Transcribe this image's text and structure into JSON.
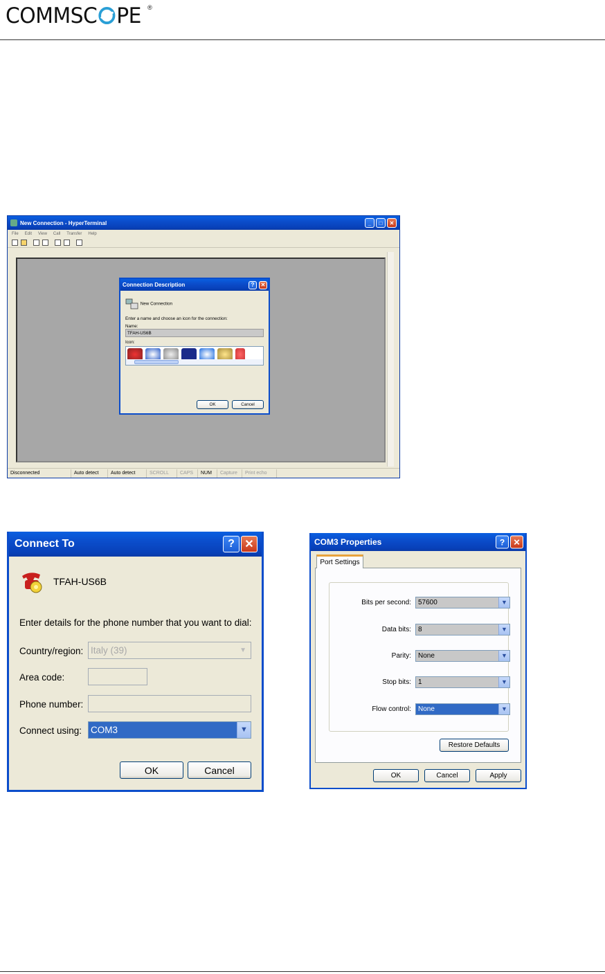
{
  "header": {
    "logo_text_1": "COMMSC",
    "logo_text_2": "PE",
    "logo_reg": "®"
  },
  "hyperterminal": {
    "title": "New Connection - HyperTerminal",
    "menu": [
      "File",
      "Edit",
      "View",
      "Call",
      "Transfer",
      "Help"
    ],
    "status": [
      "Disconnected",
      "Auto detect",
      "Auto detect",
      "SCROLL",
      "CAPS",
      "NUM",
      "Capture",
      "Print echo"
    ],
    "dialog": {
      "title": "Connection Description",
      "heading": "New Connection",
      "instruction": "Enter a name and choose an icon for the connection:",
      "name_label": "Name:",
      "name_value": "TFAH-US6B",
      "icon_label": "Icon:",
      "ok": "OK",
      "cancel": "Cancel"
    }
  },
  "connect_to": {
    "title": "Connect To",
    "connection_name": "TFAH-US6B",
    "instruction": "Enter details for the phone number that you want to dial:",
    "country_label": "Country/region:",
    "country_value": "Italy (39)",
    "area_label": "Area code:",
    "area_value": "",
    "phone_label": "Phone number:",
    "phone_value": "",
    "connect_label": "Connect using:",
    "connect_value": "COM3",
    "ok": "OK",
    "cancel": "Cancel"
  },
  "com3": {
    "title": "COM3 Properties",
    "tab": "Port Settings",
    "fields": [
      {
        "label": "Bits per second:",
        "value": "57600"
      },
      {
        "label": "Data bits:",
        "value": "8"
      },
      {
        "label": "Parity:",
        "value": "None"
      },
      {
        "label": "Stop bits:",
        "value": "1"
      },
      {
        "label": "Flow control:",
        "value": "None"
      }
    ],
    "restore": "Restore Defaults",
    "ok": "OK",
    "cancel": "Cancel",
    "apply": "Apply"
  },
  "colors": {
    "xp_blue": "#0b4dcb",
    "selection": "#316ac5",
    "dialog_bg": "#ece9d8"
  }
}
